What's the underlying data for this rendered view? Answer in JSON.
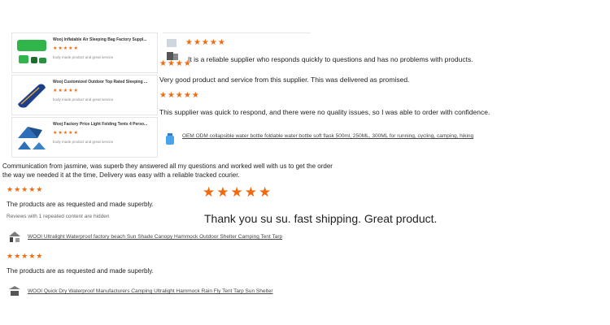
{
  "colors": {
    "star": "#f06a0f",
    "text": "#222222",
    "muted": "#888888"
  },
  "product_cards": [
    {
      "title": "Wooj Inflatable Air Sleeping Bag Factory Suppl...",
      "stars": "★★★★★",
      "desc": "body made product and great service",
      "icon": "green-air-mattress-image"
    },
    {
      "title": "Wooj Customized Outdoor Top Rated Sleeping ...",
      "stars": "★★★★★",
      "desc": "body made product and great service",
      "icon": "blue-sleeping-bag-image"
    },
    {
      "title": "Wooj Factory Price Light Folding Tents 4 Perso...",
      "stars": "★★★★★",
      "desc": "body made product and great service",
      "icon": "blue-tent-image"
    }
  ],
  "reviews_right": [
    {
      "stars": "★★★★★",
      "text": "It is a reliable supplier who responds quickly to questions and has no problems with products."
    },
    {
      "stars": "★★★★",
      "text": "Very good product and service from this supplier. This was delivered as promised."
    },
    {
      "stars": "★★★★★",
      "text": "This supplier was quick to respond, and there were no quality issues, so I was able to order with confidence.",
      "product_link": "OEM ODM collapsible water bottle foldable water bottle soft flask 500ml, 250ML, 300ML for running, cycling, camping, hiking"
    }
  ],
  "communication_review": "Communication from jasmine, was superb they answered all my questions and worked well with us to get the order the way we needed it at the time, Delivery was easy with a reliable tracked courier.",
  "big_review": {
    "stars": "★★★★★",
    "text": "Thank you su su. fast shipping. Great product."
  },
  "reviews_left": [
    {
      "stars": "★★★★★",
      "text": "The products are as requested and made superbly.",
      "note": "Reviews with 1 repeated content are hidden",
      "product_link": "WOOI Ultralight Waterproof factory beach Sun Shade Canopy Hammock Outdoor Shelter Camping Tent Tarp"
    },
    {
      "stars": "★★★★★",
      "text": "The products are as requested and made superbly.",
      "product_link": "WOOI Quick Dry Waterproof Manufacturers Camping Ultralight Hammock Rain Fly Tent Tarp Sun Shelter"
    }
  ]
}
